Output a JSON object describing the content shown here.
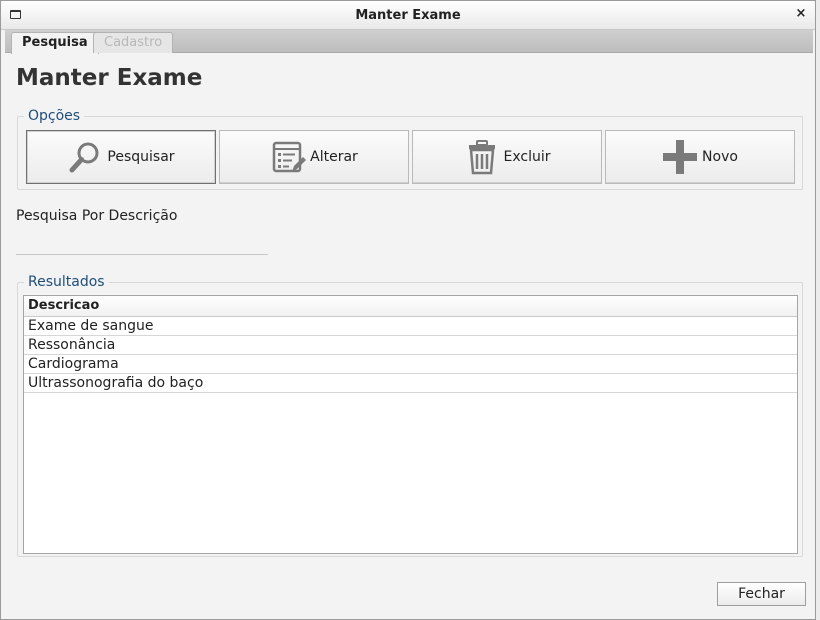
{
  "window": {
    "title": "Manter Exame",
    "close_symbol": "×"
  },
  "tabs": [
    {
      "label": "Pesquisa",
      "state": "active"
    },
    {
      "label": "Cadastro",
      "state": "disabled"
    }
  ],
  "page_title": "Manter Exame",
  "options": {
    "legend": "Opções",
    "buttons": [
      {
        "label": "Pesquisar",
        "icon": "magnifier-icon"
      },
      {
        "label": "Alterar",
        "icon": "edit-document-icon"
      },
      {
        "label": "Excluir",
        "icon": "trash-icon"
      },
      {
        "label": "Novo",
        "icon": "plus-icon"
      }
    ]
  },
  "search": {
    "label": "Pesquisa Por Descrição",
    "value": ""
  },
  "results": {
    "legend": "Resultados",
    "header": "Descricao",
    "rows": [
      "Exame de sangue",
      "Ressonância",
      "Cardiograma",
      "Ultrassonografia do baço"
    ]
  },
  "footer": {
    "close_label": "Fechar"
  },
  "colors": {
    "legend_text": "#1f4e79",
    "icon_gray": "#7a7a7a"
  }
}
